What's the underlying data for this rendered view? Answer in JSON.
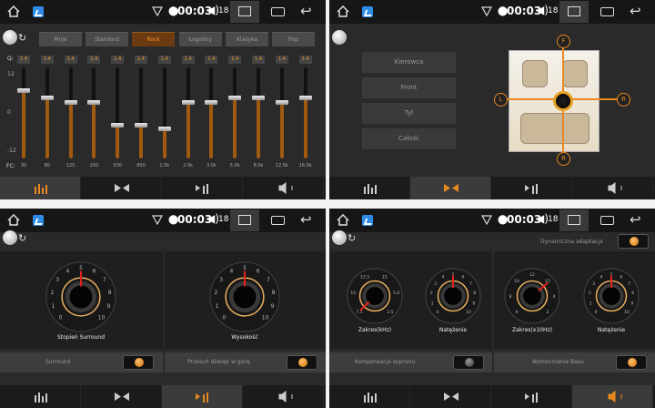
{
  "status": {
    "time": "00:03",
    "volume": "18"
  },
  "equalizer": {
    "presets": [
      "Moje",
      "Standard",
      "Rock",
      "Łagodny",
      "Klasyka",
      "Pop"
    ],
    "selected_preset": "Rock",
    "q_label": "Q:",
    "fc_label": "FC:",
    "scale": [
      "12",
      "0",
      "-12"
    ],
    "bands": [
      {
        "freq": "30",
        "q": "1.4",
        "gain": 6
      },
      {
        "freq": "80",
        "q": "1.4",
        "gain": 4
      },
      {
        "freq": "125",
        "q": "1.4",
        "gain": 3
      },
      {
        "freq": "200",
        "q": "1.4",
        "gain": 3
      },
      {
        "freq": "500",
        "q": "1.4",
        "gain": -3
      },
      {
        "freq": "800",
        "q": "1.4",
        "gain": -3
      },
      {
        "freq": "1.0k",
        "q": "1.4",
        "gain": -4
      },
      {
        "freq": "2.0k",
        "q": "1.4",
        "gain": 3
      },
      {
        "freq": "3.0k",
        "q": "1.4",
        "gain": 3
      },
      {
        "freq": "5.0k",
        "q": "1.4",
        "gain": 4
      },
      {
        "freq": "8.0k",
        "q": "1.4",
        "gain": 4
      },
      {
        "freq": "12.5k",
        "q": "1.4",
        "gain": 3
      },
      {
        "freq": "16.0k",
        "q": "1.4",
        "gain": 4
      }
    ],
    "accent": "#f39a2d"
  },
  "balance": {
    "positions": [
      "Kierowca",
      "Front",
      "Tył",
      "Całość"
    ],
    "markers": {
      "front": "F",
      "left": "L",
      "right": "R",
      "rear": "R"
    }
  },
  "surround": {
    "dial1_label": "Stopień Surround",
    "dial2_label": "Wysokość",
    "option1": "Surround",
    "option2": "Przesuń dźwięk w górę",
    "option1_on": true,
    "option2_on": true
  },
  "bass_treble": {
    "dynamic_label": "Dynamiczna adaptacja",
    "dial_labels": [
      "Zakres(kHz)",
      "Natężenie",
      "Zakres(x10Hz)",
      "Natężenie"
    ],
    "dial1_ticks": [
      "7.5",
      "10",
      "12.5",
      "15",
      "5.0",
      "2.5"
    ],
    "dial3_ticks": [
      "6",
      "8",
      "10",
      "12",
      "15",
      "4",
      "2"
    ],
    "option1": "Kompensacja sopranu",
    "option2": "Wzmocnienie Basu",
    "option1_on": false,
    "option2_on": true
  },
  "dial_ticks": [
    "0",
    "1",
    "2",
    "3",
    "4",
    "5",
    "6",
    "7",
    "8",
    "9",
    "10"
  ]
}
